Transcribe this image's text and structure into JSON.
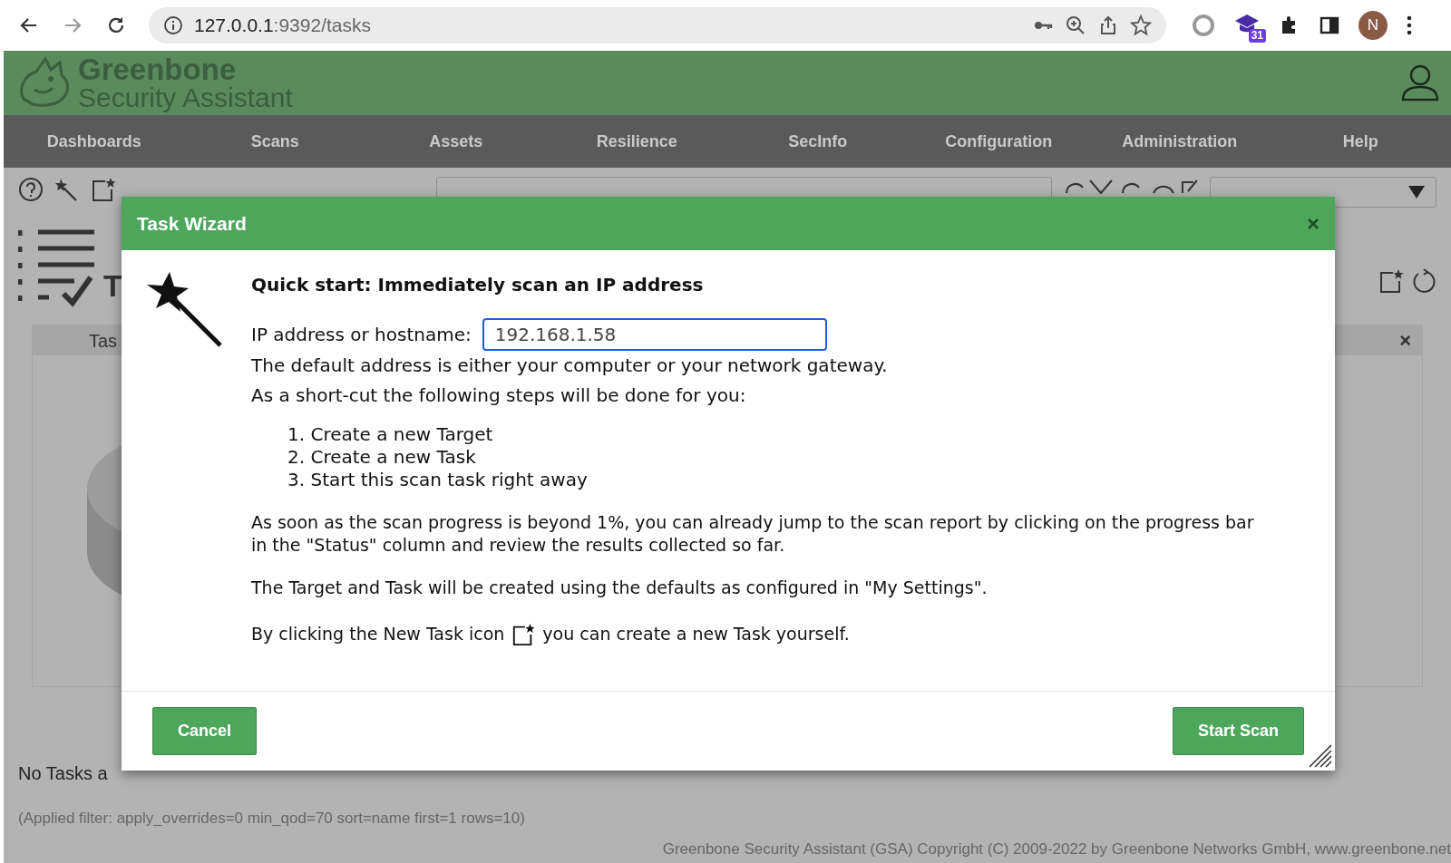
{
  "browser": {
    "url_host": "127.0.0.1",
    "url_path": ":9392/tasks",
    "extension_badge": "31",
    "avatar": "N"
  },
  "header": {
    "title": "Greenbone",
    "subtitle": "Security Assistant"
  },
  "nav": [
    "Dashboards",
    "Scans",
    "Assets",
    "Resilience",
    "SecInfo",
    "Configuration",
    "Administration",
    "Help"
  ],
  "page_title": "T",
  "panel": {
    "header": "Tas",
    "close": "×"
  },
  "empty_text": "No Tasks a",
  "applied_filter": "(Applied filter: apply_overrides=0 min_qod=70 sort=name first=1 rows=10)",
  "footer": "Greenbone Security Assistant (GSA) Copyright (C) 2009-2022 by Greenbone Networks GmbH, www.greenbone.net",
  "dialog": {
    "title": "Task Wizard",
    "close": "×",
    "heading": "Quick start: Immediately scan an IP address",
    "field": {
      "label": "IP address or hostname:",
      "value": "192.168.1.58"
    },
    "intro": [
      "The default address is either your computer or your network gateway.",
      "As a short-cut the following steps will be done for you:"
    ],
    "steps": [
      "1. Create a new Target",
      "2. Create a new Task",
      "3. Start this scan task right away"
    ],
    "notes": [
      "As soon as the scan progress is beyond 1%, you can already jump to the scan report by clicking on the progress bar in the \"Status\" column and review the results collected so far.",
      "The Target and Task will be created using the defaults as configured in \"My Settings\"."
    ],
    "hint_before": "By clicking the New Task icon",
    "hint_after": "you can create a new Task yourself.",
    "buttons": [
      "Cancel",
      "Start Scan"
    ]
  }
}
